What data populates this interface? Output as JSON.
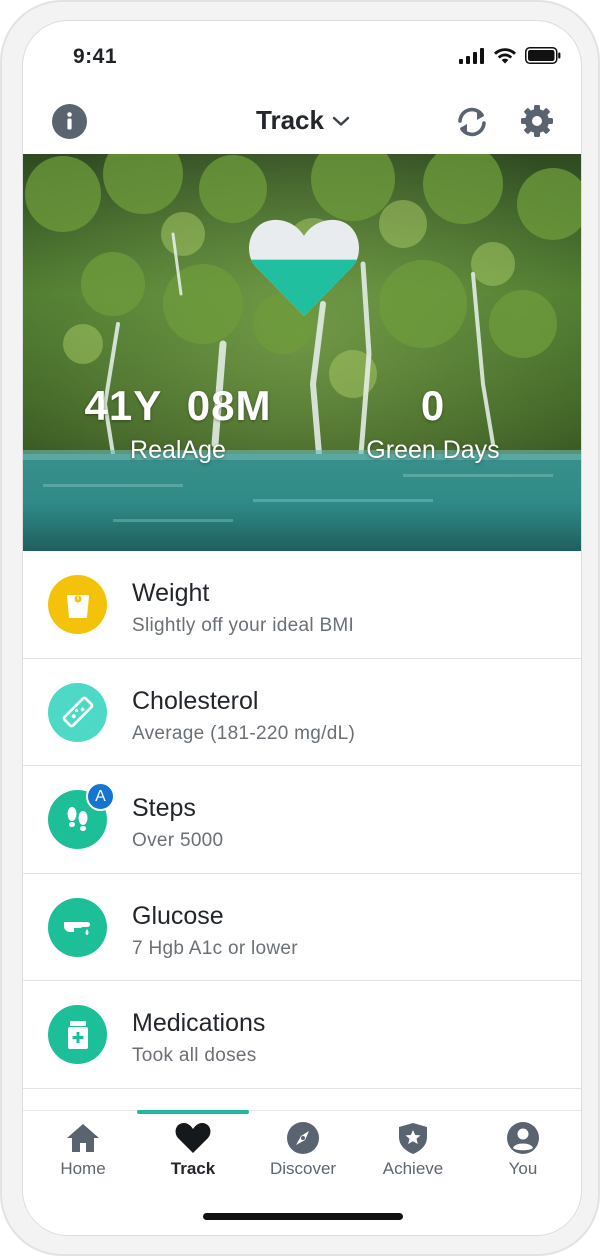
{
  "status": {
    "time": "9:41",
    "icons": [
      "cellular-signal-icon",
      "wifi-icon",
      "battery-icon"
    ]
  },
  "header": {
    "title": "Track",
    "icons": [
      "info-icon",
      "chevron-down-icon",
      "sync-icon",
      "gear-icon"
    ]
  },
  "hero": {
    "realage_value": "41Y  08M",
    "realage_label": "RealAge",
    "green_days_value": "0",
    "green_days_label": "Green Days",
    "heart_fill_fraction": 0.58,
    "colors": {
      "heart_fill": "#1fbf9f",
      "heart_empty": "#e8ecee"
    }
  },
  "track_items": [
    {
      "title": "Weight",
      "subtitle": "Slightly off your ideal BMI",
      "icon": "scale-icon",
      "color": "#f5c20b"
    },
    {
      "title": "Cholesterol",
      "subtitle": "Average (181-220 mg/dL)",
      "icon": "artery-icon",
      "color": "#4ed9c6"
    },
    {
      "title": "Steps",
      "subtitle": "Over 5000",
      "icon": "footsteps-icon",
      "color": "#1cbf97",
      "badge": "A"
    },
    {
      "title": "Glucose",
      "subtitle": "7 Hgb A1c or lower",
      "icon": "finger-prick-icon",
      "color": "#1cbf97"
    },
    {
      "title": "Medications",
      "subtitle": "Took all doses",
      "icon": "pill-bottle-icon",
      "color": "#1cbf97"
    }
  ],
  "tabs": [
    {
      "label": "Home",
      "icon": "home-icon"
    },
    {
      "label": "Track",
      "icon": "heart-icon",
      "active": true
    },
    {
      "label": "Discover",
      "icon": "compass-icon"
    },
    {
      "label": "Achieve",
      "icon": "shield-star-icon"
    },
    {
      "label": "You",
      "icon": "user-icon"
    }
  ],
  "colors": {
    "accent": "#1eb89c",
    "icon_gray": "#5a6470"
  }
}
